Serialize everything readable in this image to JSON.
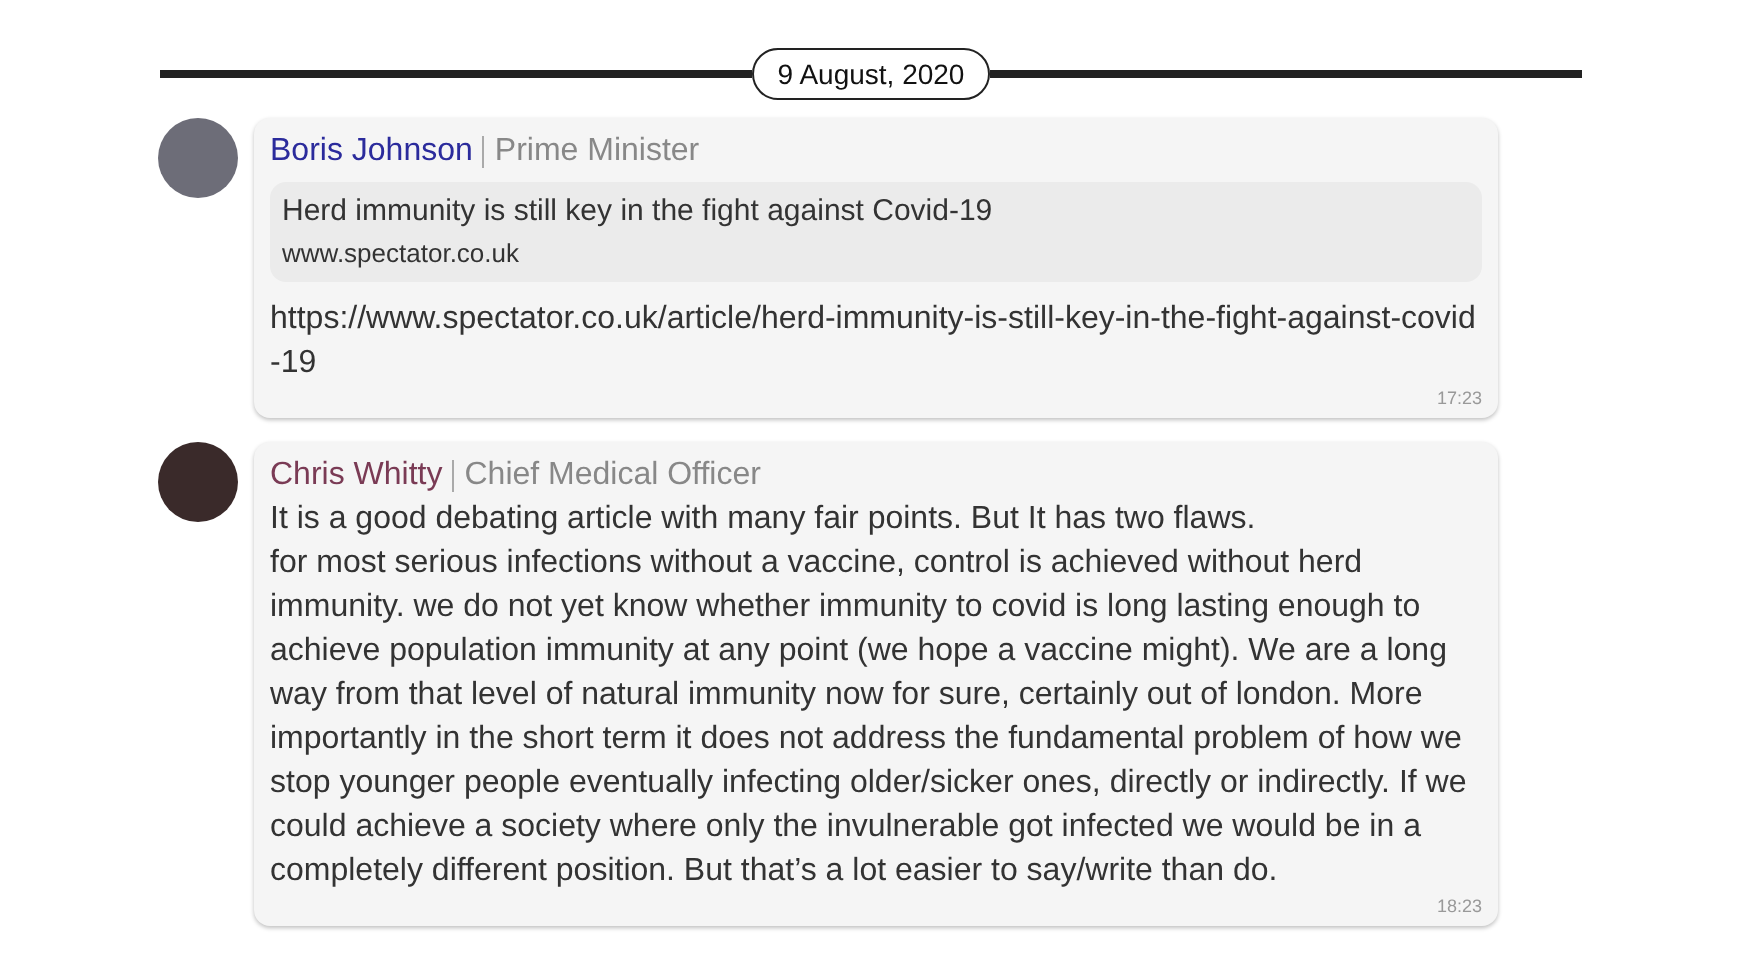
{
  "date_divider": "9 August, 2020",
  "messages": [
    {
      "author": "Boris Johnson",
      "role": "Prime Minister",
      "color": "#2b2b9c",
      "link_preview": {
        "title": "Herd immunity is still key in the fight against Covid-19",
        "site": "www.spectator.co.uk"
      },
      "text": "https://www.spectator.co.uk/article/herd-immunity-is-still-key-in-the-fight-against-covid-19",
      "time": "17:23"
    },
    {
      "author": "Chris Whitty",
      "role": "Chief Medical Officer",
      "color": "#7a3b55",
      "text": "It is a good debating article with many fair points. But It has two flaws.\nfor most serious infections without a vaccine, control is achieved without herd immunity. we do not yet know whether immunity to covid is long lasting enough to achieve population immunity at any point (we hope a vaccine might). We are a long way from that level of natural immunity now for sure, certainly out of london. More importantly in the short term it does not address the fundamental problem of how we stop younger people eventually infecting older/sicker ones, directly or indirectly. If we could achieve a society where only the invulnerable got infected we would be in a completely different position. But that’s a lot easier to say/write than do.",
      "time": "18:23"
    }
  ]
}
